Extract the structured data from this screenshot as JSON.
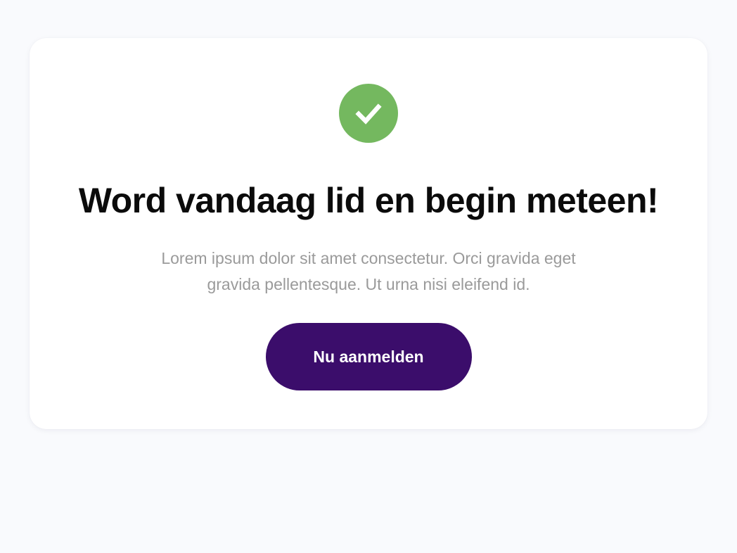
{
  "theme": {
    "success_color": "#74b85f",
    "accent_color": "#3b0d6b"
  },
  "card": {
    "icon": "check-circle-icon",
    "headline": "Word vandaag lid en begin meteen!",
    "description_line1": "Lorem ipsum dolor sit amet consectetur. Orci gravida eget",
    "description_line2": "gravida pellentesque. Ut urna nisi eleifend id.",
    "button_label": "Nu aanmelden"
  }
}
